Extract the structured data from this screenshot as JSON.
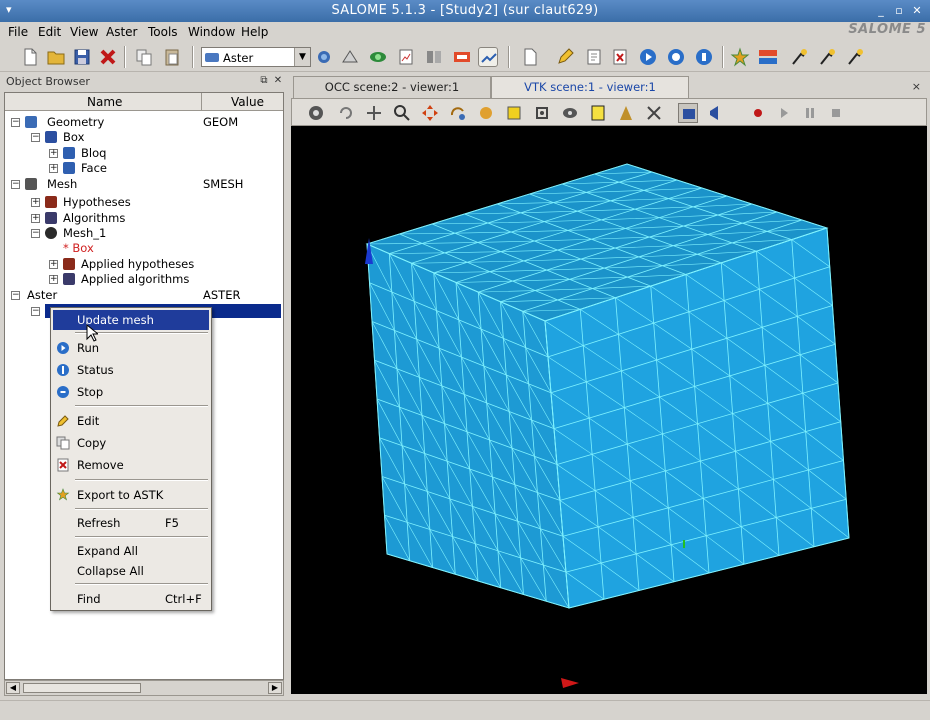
{
  "window": {
    "title": "SALOME 5.1.3 - [Study2] (sur claut629)",
    "logo": "SALOME 5"
  },
  "menu": [
    "File",
    "Edit",
    "View",
    "Aster",
    "Tools",
    "Window",
    "Help"
  ],
  "toolbar": {
    "module_combo": "Aster",
    "icons": [
      "new-icon",
      "open-icon",
      "save-icon",
      "close-study-icon",
      "copy-icon",
      "paste-icon",
      "module-combo",
      "occ-icon",
      "smesh-icon",
      "viewer-icon",
      "plot-icon",
      "table-icon",
      "python-icon",
      "dump-icon",
      "new-doc-icon",
      "edit-icon",
      "copy-file-icon",
      "remove-icon",
      "run-icon",
      "status-icon",
      "stop-icon",
      "astk-icon",
      "pre-aster-icon",
      "wizard-1-icon",
      "wizard-2-icon",
      "wizard-3-icon"
    ]
  },
  "object_browser": {
    "title": "Object Browser",
    "col_name": "Name",
    "col_value": "Value",
    "rows": [
      {
        "label": "Geometry",
        "value": "GEOM",
        "expander": "−",
        "icon_color": "#3a6bb5"
      },
      {
        "label": "Box",
        "value": "",
        "expander": "−",
        "icon_color": "#2b4fa0"
      },
      {
        "label": "Bloq",
        "value": "",
        "expander": "+",
        "icon_color": "#2f5fb0"
      },
      {
        "label": "Face",
        "value": "",
        "expander": "+",
        "icon_color": "#2f5fb0"
      },
      {
        "label": "Mesh",
        "value": "SMESH",
        "expander": "−",
        "icon_color": "#555555"
      },
      {
        "label": "Hypotheses",
        "value": "",
        "expander": "+",
        "icon_color": "#8a2a1a"
      },
      {
        "label": "Algorithms",
        "value": "",
        "expander": "+",
        "icon_color": "#3a3a6a"
      },
      {
        "label": "Mesh_1",
        "value": "",
        "expander": "−",
        "icon_color": "#2a2a2a"
      },
      {
        "label": "* Box",
        "value": "",
        "expander": "",
        "icon_color": ""
      },
      {
        "label": "Applied hypotheses",
        "value": "",
        "expander": "+",
        "icon_color": "#8a2a1a"
      },
      {
        "label": "Applied algorithms",
        "value": "",
        "expander": "+",
        "icon_color": "#3a3a6a"
      },
      {
        "label": "Aster",
        "value": "ASTER",
        "expander": "−",
        "icon_color": ""
      }
    ]
  },
  "context_menu": {
    "items": [
      {
        "label": "Update mesh",
        "shortcut": "",
        "icon": "",
        "highlighted": true
      },
      {
        "label": "Run",
        "shortcut": "",
        "icon": "run-icon"
      },
      {
        "label": "Status",
        "shortcut": "",
        "icon": "status-icon"
      },
      {
        "label": "Stop",
        "shortcut": "",
        "icon": "stop-icon"
      },
      {
        "label": "Edit",
        "shortcut": "",
        "icon": "edit-icon"
      },
      {
        "label": "Copy",
        "shortcut": "",
        "icon": "copy-icon"
      },
      {
        "label": "Remove",
        "shortcut": "",
        "icon": "remove-icon"
      },
      {
        "label": "Export to ASTK",
        "shortcut": "",
        "icon": "astk-icon"
      },
      {
        "label": "Refresh",
        "shortcut": "F5",
        "icon": ""
      },
      {
        "label": "Expand All",
        "shortcut": "",
        "icon": ""
      },
      {
        "label": "Collapse All",
        "shortcut": "",
        "icon": ""
      },
      {
        "label": "Find",
        "shortcut": "Ctrl+F",
        "icon": ""
      }
    ]
  },
  "viewer": {
    "tabs": [
      {
        "label": "OCC scene:2 - viewer:1",
        "active": false
      },
      {
        "label": "VTK scene:1 - viewer:1",
        "active": true
      }
    ],
    "close": "×",
    "mesh_color": "#1fa3e0",
    "mesh_line_color": "#7ff2ff",
    "background": "#000000"
  }
}
